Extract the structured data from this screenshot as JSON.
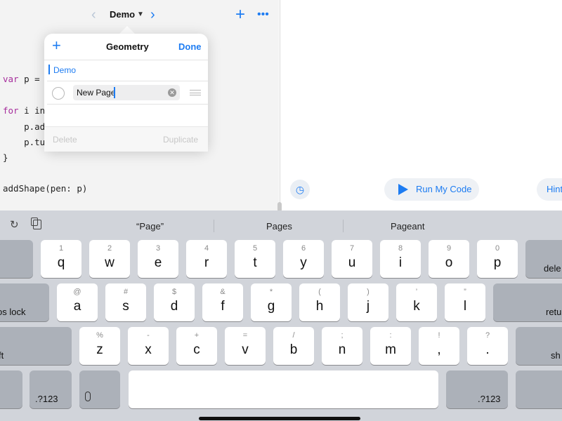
{
  "toolbar": {
    "back_icon": "chevron-left-icon",
    "title": "Demo",
    "forward_icon": "chevron-right-icon",
    "add_icon": "plus-icon",
    "more_icon": "ellipsis-icon"
  },
  "code": {
    "lines": [
      {
        "kw": "var",
        "text": " p = P"
      },
      {
        "kw": "for",
        "text": " i in"
      },
      {
        "kw": "",
        "text": "    p.ado"
      },
      {
        "kw": "",
        "text": "    p.tu"
      },
      {
        "kw": "",
        "text": "}"
      },
      {
        "kw": "",
        "text": "addShape(pen: p)"
      }
    ]
  },
  "popover": {
    "title": "Geometry",
    "done_label": "Done",
    "add_icon": "plus-icon",
    "section_label": "Demo",
    "page_field_value": "New Page",
    "clear_icon": "clear-circle-icon",
    "reorder_icon": "reorder-icon",
    "delete_label": "Delete",
    "duplicate_label": "Duplicate"
  },
  "live_view": {
    "run_label": "Run My Code",
    "hint_label": "Hint",
    "speed_icon": "speedometer-icon",
    "run_icon": "play-icon"
  },
  "keyboard": {
    "suggestions": [
      "“Page”",
      "Pages",
      "Pageant"
    ],
    "row1": [
      [
        "1",
        "q"
      ],
      [
        "2",
        "w"
      ],
      [
        "3",
        "e"
      ],
      [
        "4",
        "r"
      ],
      [
        "5",
        "t"
      ],
      [
        "6",
        "y"
      ],
      [
        "7",
        "u"
      ],
      [
        "8",
        "i"
      ],
      [
        "9",
        "o"
      ],
      [
        "0",
        "p"
      ]
    ],
    "row2": [
      [
        "@",
        "a"
      ],
      [
        "#",
        "s"
      ],
      [
        "$",
        "d"
      ],
      [
        "&",
        "f"
      ],
      [
        "*",
        "g"
      ],
      [
        "(",
        "h"
      ],
      [
        ")",
        "j"
      ],
      [
        "’",
        "k"
      ],
      [
        "”",
        "l"
      ]
    ],
    "row3": [
      [
        "%",
        "z"
      ],
      [
        "-",
        "x"
      ],
      [
        "+",
        "c"
      ],
      [
        "=",
        "v"
      ],
      [
        "/",
        "b"
      ],
      [
        ";",
        "n"
      ],
      [
        ":",
        "m"
      ],
      [
        "!",
        ","
      ],
      [
        "?",
        "."
      ]
    ],
    "delete_label": "dele",
    "caps_label": "os lock",
    "return_label": "retu",
    "shift_left_label": "ft",
    "shift_right_label": "sh",
    "numbers_label": ".?123",
    "mic_icon": "microphone-icon",
    "redo_icon": "redo-icon",
    "paste_icon": "paste-icon"
  },
  "colors": {
    "accent": "#1d7cf2",
    "keyword": "#a62d9c",
    "keyboard_bg": "#d1d4da"
  }
}
